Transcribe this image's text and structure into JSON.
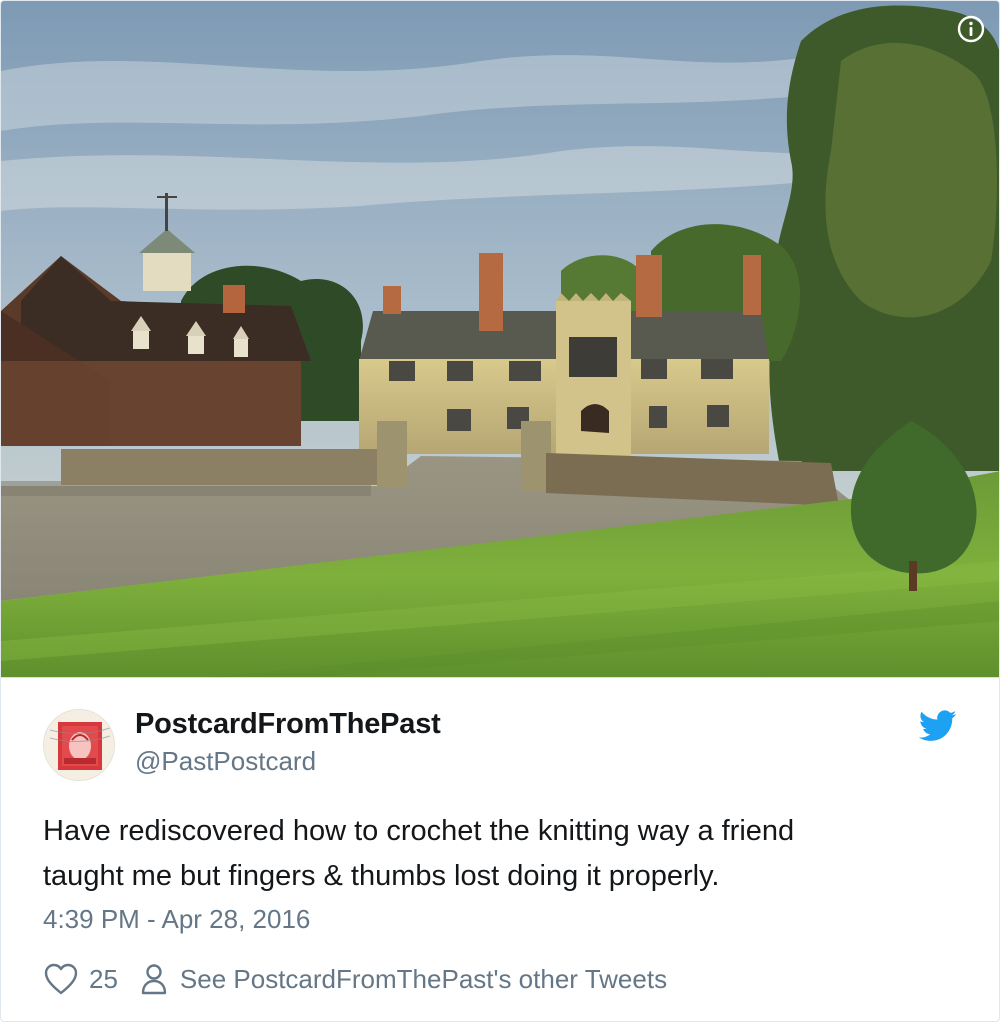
{
  "media": {
    "alt": "Postcard photo of a stone manor house with chimneys, gatehouse and green lawn",
    "info_icon": "info-icon"
  },
  "author": {
    "display_name": "PostcardFromThePast",
    "handle": "@PastPostcard",
    "avatar_icon": "postage-stamp-avatar"
  },
  "brand": {
    "icon": "twitter-bird-icon",
    "color": "#1da1f2"
  },
  "tweet": {
    "text_line1": "Have rediscovered how to crochet the knitting way a friend",
    "text_line2": "taught me but fingers & thumbs lost doing it properly.",
    "timestamp": "4:39 PM - Apr 28, 2016"
  },
  "actions": {
    "like_icon": "heart-icon",
    "like_count": "25",
    "profile_icon": "person-icon",
    "other_tweets_label": "See PostcardFromThePast's other Tweets"
  },
  "colors": {
    "text": "#14171a",
    "muted": "#657786",
    "border": "#e1e8ed"
  }
}
